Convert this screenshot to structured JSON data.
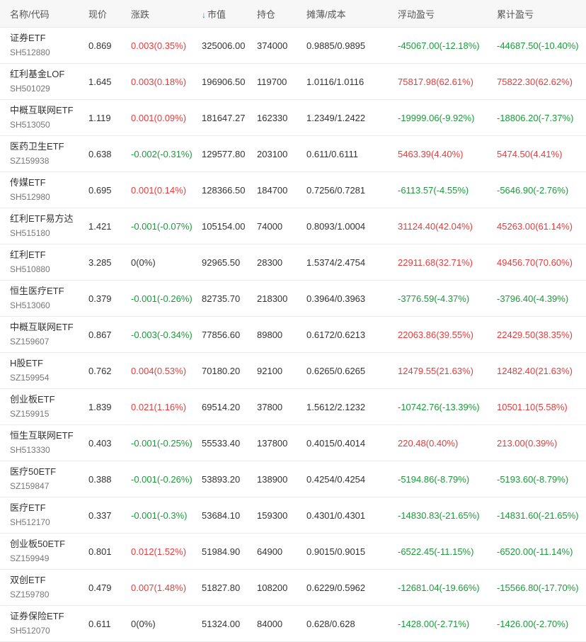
{
  "headers": {
    "name": "名称/代码",
    "price": "现价",
    "change": "涨跌",
    "sort_icon": "↓",
    "market_value": "市值",
    "position": "持仓",
    "cost": "摊薄/成本",
    "floating_pl": "浮动盈亏",
    "cumulative_pl": "累计盈亏"
  },
  "colors": {
    "up": "#e83b3b",
    "down": "#1a9b3a"
  },
  "rows": [
    {
      "name": "证券ETF",
      "code": "SH512880",
      "price": "0.869",
      "change": "0.003(0.35%)",
      "mv": "325006.00",
      "pos": "374000",
      "cost": "0.9885/0.9895",
      "float": "-45067.00(-12.18%)",
      "cum": "-44687.50(-10.40%)",
      "cc": "red",
      "fc": "green",
      "uc": "green"
    },
    {
      "name": "红利基金LOF",
      "code": "SH501029",
      "price": "1.645",
      "change": "0.003(0.18%)",
      "mv": "196906.50",
      "pos": "119700",
      "cost": "1.0116/1.0116",
      "float": "75817.98(62.61%)",
      "cum": "75822.30(62.62%)",
      "cc": "red",
      "fc": "red",
      "uc": "red"
    },
    {
      "name": "中概互联网ETF",
      "code": "SH513050",
      "price": "1.119",
      "change": "0.001(0.09%)",
      "mv": "181647.27",
      "pos": "162330",
      "cost": "1.2349/1.2422",
      "float": "-19999.06(-9.92%)",
      "cum": "-18806.20(-7.37%)",
      "cc": "red",
      "fc": "green",
      "uc": "green"
    },
    {
      "name": "医药卫生ETF",
      "code": "SZ159938",
      "price": "0.638",
      "change": "-0.002(-0.31%)",
      "mv": "129577.80",
      "pos": "203100",
      "cost": "0.611/0.6111",
      "float": "5463.39(4.40%)",
      "cum": "5474.50(4.41%)",
      "cc": "green",
      "fc": "red",
      "uc": "red"
    },
    {
      "name": "传媒ETF",
      "code": "SH512980",
      "price": "0.695",
      "change": "0.001(0.14%)",
      "mv": "128366.50",
      "pos": "184700",
      "cost": "0.7256/0.7281",
      "float": "-6113.57(-4.55%)",
      "cum": "-5646.90(-2.76%)",
      "cc": "red",
      "fc": "green",
      "uc": "green"
    },
    {
      "name": "红利ETF易方达",
      "code": "SH515180",
      "price": "1.421",
      "change": "-0.001(-0.07%)",
      "mv": "105154.00",
      "pos": "74000",
      "cost": "0.8093/1.0004",
      "float": "31124.40(42.04%)",
      "cum": "45263.00(61.14%)",
      "cc": "green",
      "fc": "red",
      "uc": "red"
    },
    {
      "name": "红利ETF",
      "code": "SH510880",
      "price": "3.285",
      "change": "0(0%)",
      "mv": "92965.50",
      "pos": "28300",
      "cost": "1.5374/2.4754",
      "float": "22911.68(32.71%)",
      "cum": "49456.70(70.60%)",
      "cc": "plain",
      "fc": "red",
      "uc": "red"
    },
    {
      "name": "恒生医疗ETF",
      "code": "SH513060",
      "price": "0.379",
      "change": "-0.001(-0.26%)",
      "mv": "82735.70",
      "pos": "218300",
      "cost": "0.3964/0.3963",
      "float": "-3776.59(-4.37%)",
      "cum": "-3796.40(-4.39%)",
      "cc": "green",
      "fc": "green",
      "uc": "green"
    },
    {
      "name": "中概互联网ETF",
      "code": "SZ159607",
      "price": "0.867",
      "change": "-0.003(-0.34%)",
      "mv": "77856.60",
      "pos": "89800",
      "cost": "0.6172/0.6213",
      "float": "22063.86(39.55%)",
      "cum": "22429.50(38.35%)",
      "cc": "green",
      "fc": "red",
      "uc": "red"
    },
    {
      "name": "H股ETF",
      "code": "SZ159954",
      "price": "0.762",
      "change": "0.004(0.53%)",
      "mv": "70180.20",
      "pos": "92100",
      "cost": "0.6265/0.6265",
      "float": "12479.55(21.63%)",
      "cum": "12482.40(21.63%)",
      "cc": "red",
      "fc": "red",
      "uc": "red"
    },
    {
      "name": "创业板ETF",
      "code": "SZ159915",
      "price": "1.839",
      "change": "0.021(1.16%)",
      "mv": "69514.20",
      "pos": "37800",
      "cost": "1.5612/2.1232",
      "float": "-10742.76(-13.39%)",
      "cum": "10501.10(5.58%)",
      "cc": "red",
      "fc": "green",
      "uc": "red"
    },
    {
      "name": "恒生互联网ETF",
      "code": "SH513330",
      "price": "0.403",
      "change": "-0.001(-0.25%)",
      "mv": "55533.40",
      "pos": "137800",
      "cost": "0.4015/0.4014",
      "float": "220.48(0.40%)",
      "cum": "213.00(0.39%)",
      "cc": "green",
      "fc": "red",
      "uc": "red"
    },
    {
      "name": "医疗50ETF",
      "code": "SZ159847",
      "price": "0.388",
      "change": "-0.001(-0.26%)",
      "mv": "53893.20",
      "pos": "138900",
      "cost": "0.4254/0.4254",
      "float": "-5194.86(-8.79%)",
      "cum": "-5193.60(-8.79%)",
      "cc": "green",
      "fc": "green",
      "uc": "green"
    },
    {
      "name": "医疗ETF",
      "code": "SH512170",
      "price": "0.337",
      "change": "-0.001(-0.3%)",
      "mv": "53684.10",
      "pos": "159300",
      "cost": "0.4301/0.4301",
      "float": "-14830.83(-21.65%)",
      "cum": "-14831.60(-21.65%)",
      "cc": "green",
      "fc": "green",
      "uc": "green"
    },
    {
      "name": "创业板50ETF",
      "code": "SZ159949",
      "price": "0.801",
      "change": "0.012(1.52%)",
      "mv": "51984.90",
      "pos": "64900",
      "cost": "0.9015/0.9015",
      "float": "-6522.45(-11.15%)",
      "cum": "-6520.00(-11.14%)",
      "cc": "red",
      "fc": "green",
      "uc": "green"
    },
    {
      "name": "双创ETF",
      "code": "SZ159780",
      "price": "0.479",
      "change": "0.007(1.48%)",
      "mv": "51827.80",
      "pos": "108200",
      "cost": "0.6229/0.5962",
      "float": "-12681.04(-19.66%)",
      "cum": "-15566.80(-17.70%)",
      "cc": "red",
      "fc": "green",
      "uc": "green"
    },
    {
      "name": "证券保险ETF",
      "code": "SH512070",
      "price": "0.611",
      "change": "0(0%)",
      "mv": "51324.00",
      "pos": "84000",
      "cost": "0.628/0.628",
      "float": "-1428.00(-2.71%)",
      "cum": "-1426.00(-2.70%)",
      "cc": "plain",
      "fc": "green",
      "uc": "green"
    }
  ]
}
